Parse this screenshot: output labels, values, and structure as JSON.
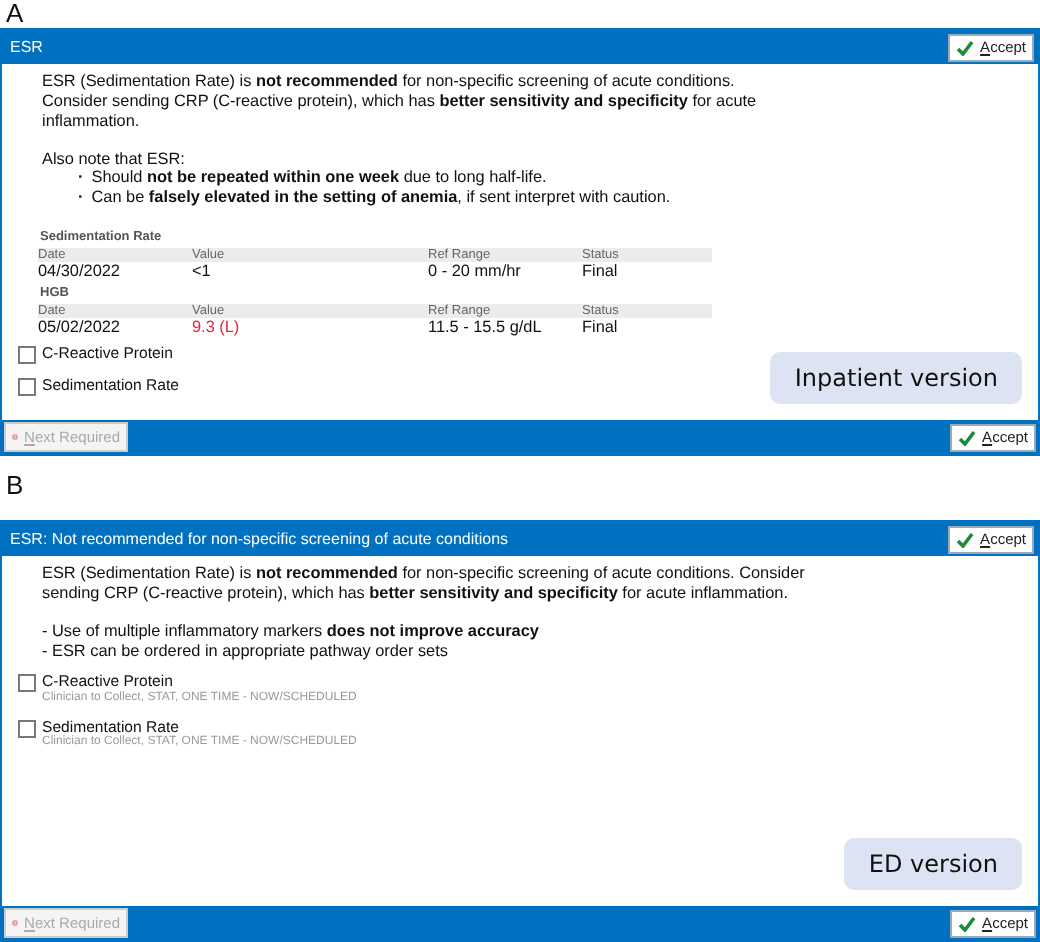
{
  "panels": [
    {
      "label": "A",
      "title": "ESR",
      "header_accept": "Accept",
      "blocks": [
        {
          "kind": "paragraph",
          "text": "ESR (Sedimentation Rate) is **not recommended** for non-specific screening of acute conditions.  Consider sending CRP (C-reactive protein), which has **better sensitivity and specificity** for acute inflammation."
        },
        {
          "kind": "paragraph",
          "text": "Also note that ESR:"
        },
        {
          "kind": "bullets",
          "marker": "·",
          "items": [
            "Should **not be repeated within one week** due to long half-life.",
            "Can be **falsely elevated in the setting of anemia**, if sent interpret with caution."
          ]
        },
        {
          "kind": "results",
          "tests": [
            {
              "name": "Sedimentation Rate",
              "columns": [
                "Date",
                "Value",
                "Ref Range",
                "Status"
              ],
              "cells": [
                "04/30/2022",
                "<1",
                "0 - 20 mm/hr",
                "Final"
              ],
              "abnormal": false
            },
            {
              "name": "HGB",
              "columns": [
                "Date",
                "Value",
                "Ref Range",
                "Status"
              ],
              "cells": [
                "05/02/2022",
                "9.3 (L)",
                "11.5 - 15.5 g/dL",
                "Final"
              ],
              "abnormal": true
            }
          ]
        }
      ],
      "orders": [
        {
          "label": "C-Reactive Protein",
          "checked": false
        },
        {
          "label": "Sedimentation Rate",
          "checked": false
        }
      ],
      "version_label": "Inpatient version",
      "footer": {
        "next": "Next Required",
        "accept": "Accept"
      }
    },
    {
      "label": "B",
      "title": "ESR: Not recommended for non-specific screening of acute conditions",
      "header_accept": "Accept",
      "blocks": [
        {
          "kind": "paragraph",
          "text": "ESR (Sedimentation Rate) is **not recommended** for non-specific screening of acute conditions. Consider sending CRP (C-reactive protein), which has **better sensitivity and specificity** for acute inflammation."
        },
        {
          "kind": "lines",
          "items": [
            "- Use of multiple inflammatory markers **does not improve accuracy**",
            "- ESR can be ordered in appropriate pathway order sets"
          ]
        }
      ],
      "orders": [
        {
          "label": "C-Reactive Protein",
          "detail": "Clinician to Collect, STAT, ONE TIME - NOW/SCHEDULED",
          "checked": false
        },
        {
          "label": "Sedimentation Rate",
          "detail": "Clinician to Collect, STAT, ONE TIME - NOW/SCHEDULED",
          "checked": false
        }
      ],
      "version_label": "ED version",
      "footer": {
        "next": "Next Required",
        "accept": "Accept"
      }
    }
  ]
}
